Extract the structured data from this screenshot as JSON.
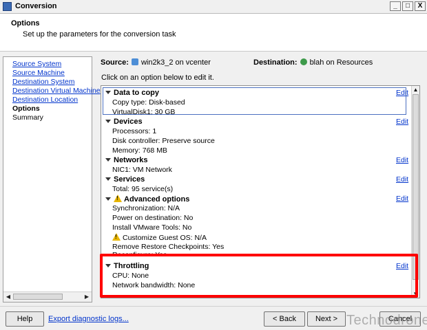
{
  "window": {
    "title": "Conversion",
    "controls": [
      "_",
      "□",
      "X"
    ]
  },
  "header": {
    "title": "Options",
    "subtitle": "Set up the parameters for the conversion task"
  },
  "nav": {
    "items": [
      {
        "label": "Source System",
        "type": "link"
      },
      {
        "label": "Source Machine",
        "type": "link"
      },
      {
        "label": "Destination System",
        "type": "link"
      },
      {
        "label": "Destination Virtual Machine",
        "type": "link"
      },
      {
        "label": "Destination Location",
        "type": "link"
      },
      {
        "label": "Options",
        "type": "current"
      },
      {
        "label": "Summary",
        "type": "plain"
      }
    ]
  },
  "source": {
    "label": "Source:",
    "value": "win2k3_2 on vcenter"
  },
  "destination": {
    "label": "Destination:",
    "value": "blah on Resources"
  },
  "hint": "Click on an option below to edit it.",
  "edit_label": "Edit",
  "sections": [
    {
      "title": "Data to copy",
      "lines": [
        "Copy type: Disk-based",
        "VirtualDisk1: 30 GB"
      ]
    },
    {
      "title": "Devices",
      "lines": [
        "Processors: 1",
        "Disk controller: Preserve source",
        "Memory: 768 MB"
      ]
    },
    {
      "title": "Networks",
      "lines": [
        "NIC1: VM Network"
      ]
    },
    {
      "title": "Services",
      "lines": [
        "Total: 95 service(s)"
      ]
    },
    {
      "title": "Advanced options",
      "lines": [
        "Synchronization: N/A",
        "Power on destination: No",
        "Install VMware Tools: No",
        "Customize Guest OS: N/A",
        "Remove Restore Checkpoints: Yes",
        "Reconfigure: Yes"
      ]
    },
    {
      "title": "Throttling",
      "lines": [
        "CPU: None",
        "Network bandwidth: None"
      ]
    }
  ],
  "footer": {
    "help": "Help",
    "export_logs": "Export diagnostic logs...",
    "back": "< Back",
    "next": "Next >",
    "cancel": "Cancel"
  },
  "watermark": "Technodrone",
  "colors": {
    "highlight": "#ff0000",
    "link": "#0033cc"
  }
}
